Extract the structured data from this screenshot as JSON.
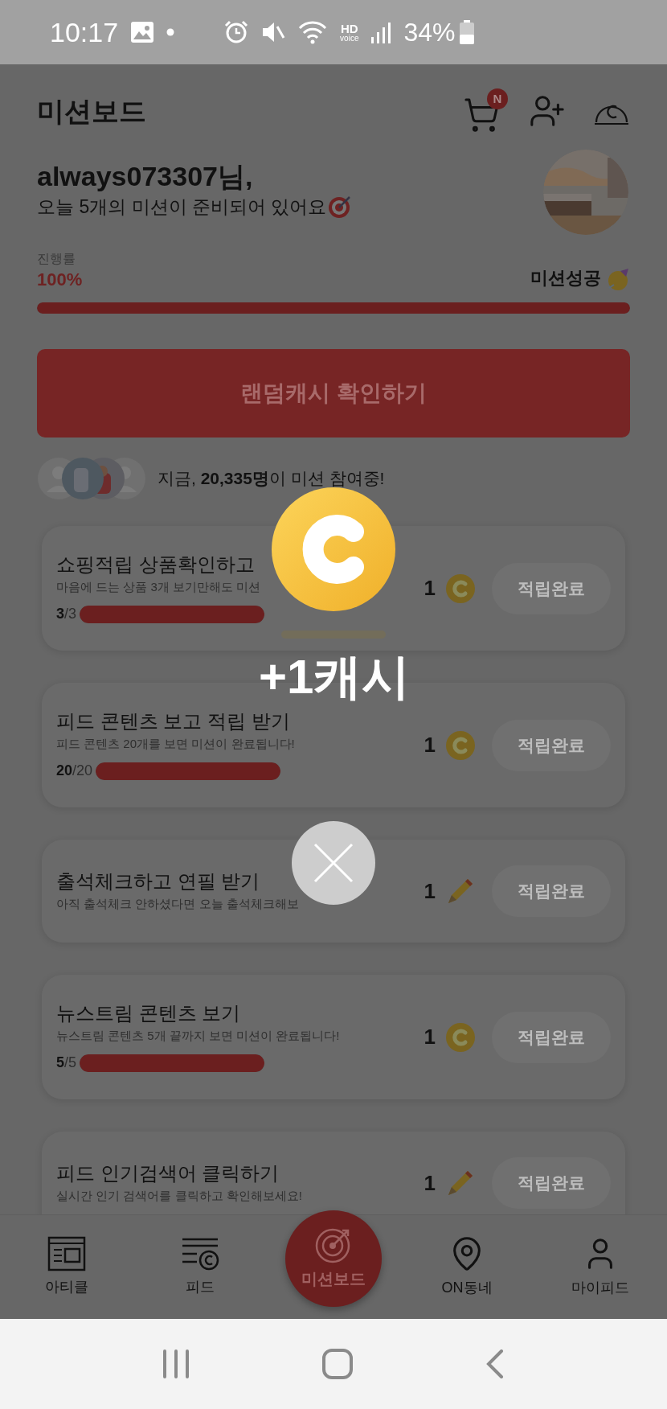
{
  "status_bar": {
    "time": "10:17",
    "network_top": "HD",
    "network_bottom": "voice",
    "battery": "34%"
  },
  "header": {
    "title": "미션보드",
    "cart_badge": "N"
  },
  "greeting": {
    "name": "always073307님,",
    "message": "오늘 5개의 미션이 준비되어 있어요"
  },
  "progress": {
    "label": "진행률",
    "value": "100%",
    "status": "미션성공",
    "level": 1
  },
  "random_cash_button": "랜덤캐시 확인하기",
  "participants": {
    "text": "지금, **20,335명**이 미션 참여중!"
  },
  "missions": [
    {
      "title": "쇼핑적립 상품확인하고",
      "description": "마음에 드는 상품 3개 보기만해도 미션",
      "count": "3",
      "total": "/3",
      "level": 1,
      "reward": "1",
      "kind": "coin",
      "button": "적립완료"
    },
    {
      "title": "피드 콘텐츠 보고 적립 받기",
      "description": "피드 콘텐츠 20개를 보면 미션이 완료됩니다!",
      "count": "20",
      "total": "/20",
      "level": 1,
      "reward": "1",
      "kind": "coin",
      "button": "적립완료"
    },
    {
      "title": "출석체크하고 연필 받기",
      "description": "아직 출석체크 안하셨다면 오늘 출석체크해보",
      "reward": "1",
      "kind": "pencil",
      "button": "적립완료"
    },
    {
      "title": "뉴스트림 콘텐츠 보기",
      "description": "뉴스트림 콘텐츠 5개 끝까지 보면 미션이 완료됩니다!",
      "count": "5",
      "total": "/5",
      "level": 1,
      "reward": "1",
      "kind": "coin",
      "button": "적립완료"
    },
    {
      "title": "피드 인기검색어 클릭하기",
      "description": "실시간 인기 검색어를 클릭하고 확인해보세요!",
      "reward": "1",
      "kind": "pencil",
      "button": "적립완료"
    }
  ],
  "reward_popup": {
    "amount": "+1캐시"
  },
  "bottom_nav": [
    {
      "label": "아티클",
      "kind": "article",
      "selected": false
    },
    {
      "label": "피드",
      "kind": "feed",
      "selected": false
    },
    {
      "label": "미션보드",
      "kind": "target",
      "selected": true
    },
    {
      "label": "ON동네",
      "kind": "pin",
      "selected": false
    },
    {
      "label": "마이피드",
      "kind": "person",
      "selected": false
    }
  ]
}
